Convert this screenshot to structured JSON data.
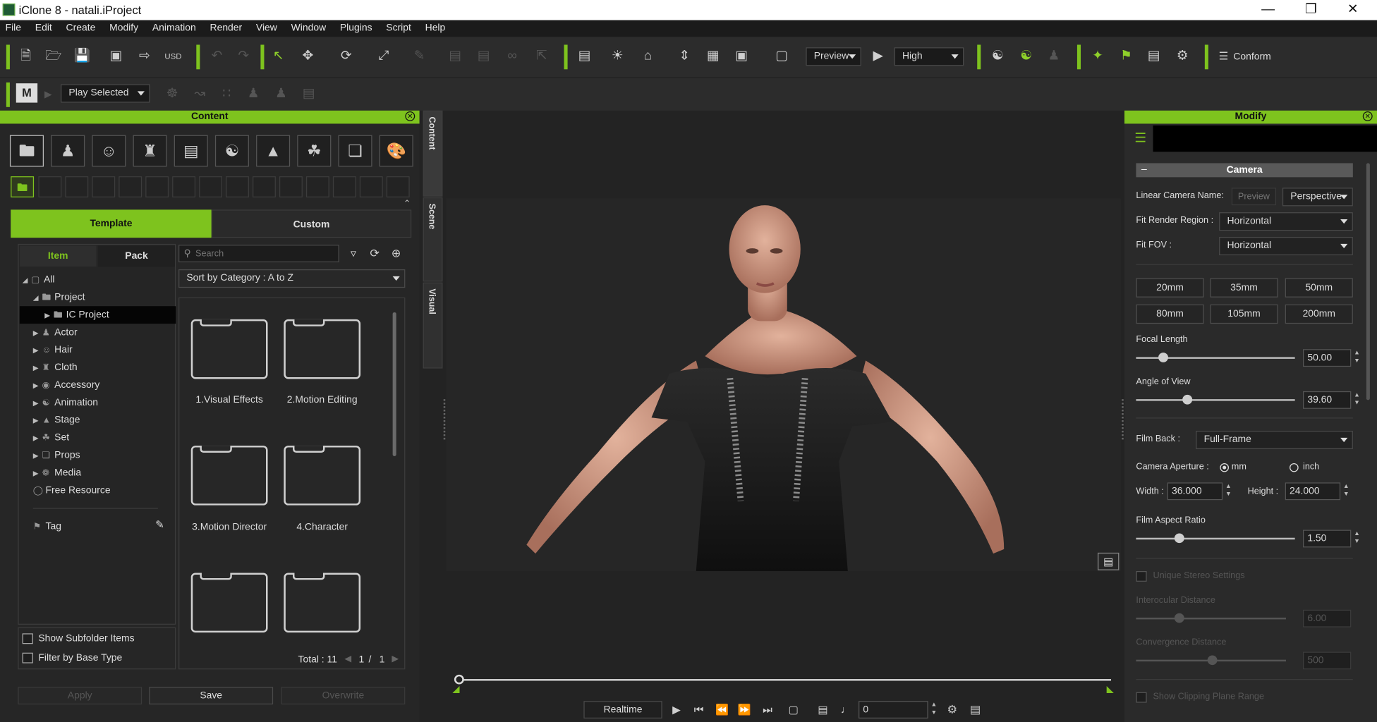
{
  "window": {
    "title": "iClone 8 - natali.iProject"
  },
  "menu": [
    "File",
    "Edit",
    "Create",
    "Modify",
    "Animation",
    "Render",
    "View",
    "Window",
    "Plugins",
    "Script",
    "Help"
  ],
  "toolbar": {
    "preview_label": "Preview",
    "quality_label": "High",
    "conform_label": "Conform",
    "play_selected_label": "Play Selected"
  },
  "content_panel": {
    "title": "Content",
    "tabs": {
      "template": "Template",
      "custom": "Custom",
      "item": "Item",
      "pack": "Pack"
    },
    "search_placeholder": "Search",
    "sort_label": "Sort by Category : A to Z",
    "tree": [
      "All",
      "Project",
      "IC Project",
      "Actor",
      "Hair",
      "Cloth",
      "Accessory",
      "Animation",
      "Stage",
      "Set",
      "Props",
      "Media",
      "Free Resource"
    ],
    "tag_label": "Tag",
    "show_subfolder_label": "Show Subfolder Items",
    "filter_base_label": "Filter by Base Type",
    "folders": [
      "1.Visual Effects",
      "2.Motion Editing",
      "3.Motion Director",
      "4.Character"
    ],
    "total_label": "Total : 11",
    "page_current": "1",
    "page_sep": "/",
    "page_total": "1",
    "apply_label": "Apply",
    "save_label": "Save",
    "overwrite_label": "Overwrite"
  },
  "side_tabs": [
    "Content",
    "Scene",
    "Visual"
  ],
  "timeline": {
    "realtime_label": "Realtime",
    "frame_value": "0"
  },
  "modify_panel": {
    "title": "Modify",
    "section": "Camera",
    "linear_camera_name_label": "Linear Camera Name:",
    "camera_name_placeholder": "Preview",
    "projection_value": "Perspective",
    "fit_render_region_label": "Fit Render Region :",
    "fit_render_region_value": "Horizontal",
    "fit_fov_label": "Fit FOV :",
    "fit_fov_value": "Horizontal",
    "lens_presets": [
      "20mm",
      "35mm",
      "50mm",
      "80mm",
      "105mm",
      "200mm"
    ],
    "focal_length_label": "Focal Length",
    "focal_length_value": "50.00",
    "focal_length_fraction": 0.17,
    "angle_of_view_label": "Angle of View",
    "angle_of_view_value": "39.60",
    "angle_of_view_fraction": 0.32,
    "film_back_label": "Film Back :",
    "film_back_value": "Full-Frame",
    "camera_aperture_label": "Camera Aperture :",
    "aperture_mm_label": "mm",
    "aperture_inch_label": "inch",
    "width_label": "Width :",
    "width_value": "36.000",
    "height_label": "Height :",
    "height_value": "24.000",
    "film_aspect_ratio_label": "Film Aspect Ratio",
    "film_aspect_ratio_value": "1.50",
    "film_aspect_ratio_fraction": 0.27,
    "unique_stereo_label": "Unique Stereo Settings",
    "interocular_label": "Interocular Distance",
    "interocular_value": "6.00",
    "convergence_label": "Convergence Distance",
    "convergence_value": "500",
    "clipping_label": "Show Clipping Plane Range"
  },
  "colors": {
    "accent": "#7ec31e",
    "panel": "#2a2a2a",
    "background": "#232323"
  }
}
